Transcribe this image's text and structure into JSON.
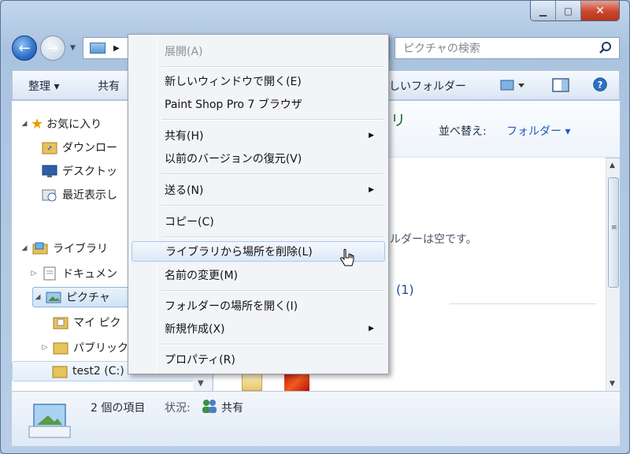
{
  "window": {
    "colors": {
      "accent": "#1c4e9e",
      "selection": "#cfe3f7"
    }
  },
  "address": {
    "search_placeholder": "ピクチャの検索"
  },
  "toolbar": {
    "organize": "整理 ▾",
    "share": "共有",
    "new_folder": "しいフォルダー"
  },
  "nav": {
    "favorites": "お気に入り",
    "downloads": "ダウンロー",
    "desktop": "デスクトッ",
    "recent": "最近表示し",
    "libraries": "ライブラリ",
    "documents": "ドキュメン",
    "pictures": "ピクチャ",
    "my_pictures": "マイ ピク",
    "public": "パブリック",
    "test2": "test2 (C:)"
  },
  "main": {
    "header_partial": "ラリ",
    "sort_label": "並べ替え:",
    "sort_value": "フォルダー ▾",
    "empty_text": "ルダーは空です。",
    "group_count": "(1)"
  },
  "status": {
    "count": "2 個の項目",
    "state_label": "状況:",
    "state_value": "共有"
  },
  "context_menu": {
    "items": [
      {
        "label": "展開(A)"
      },
      {
        "label": "新しいウィンドウで開く(E)"
      },
      {
        "label": "Paint Shop Pro 7 ブラウザ"
      },
      {
        "label": "共有(H)"
      },
      {
        "label": "以前のバージョンの復元(V)"
      },
      {
        "label": "送る(N)"
      },
      {
        "label": "コピー(C)"
      },
      {
        "label": "ライブラリから場所を削除(L)"
      },
      {
        "label": "名前の変更(M)"
      },
      {
        "label": "フォルダーの場所を開く(I)"
      },
      {
        "label": "新規作成(X)"
      },
      {
        "label": "プロパティ(R)"
      }
    ]
  }
}
